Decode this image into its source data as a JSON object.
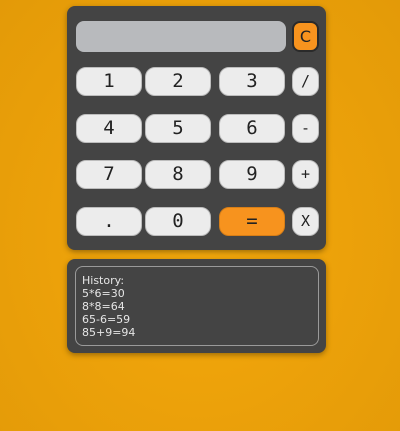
{
  "display": {
    "value": ""
  },
  "clear_label": "C",
  "keys": {
    "k1": "1",
    "k2": "2",
    "k3": "3",
    "divide": "/",
    "k4": "4",
    "k5": "5",
    "k6": "6",
    "minus": "-",
    "k7": "7",
    "k8": "8",
    "k9": "9",
    "plus": "+",
    "dot": ".",
    "k0": "0",
    "equals": "=",
    "multiply": "X"
  },
  "history": {
    "title": "History:",
    "entries": [
      "5*6=30",
      "8*8=64",
      "65-6=59",
      "85+9=94"
    ]
  },
  "colors": {
    "accent": "#f7931e",
    "panel": "#444444",
    "display": "#b8babd",
    "background": "#eda20a"
  }
}
